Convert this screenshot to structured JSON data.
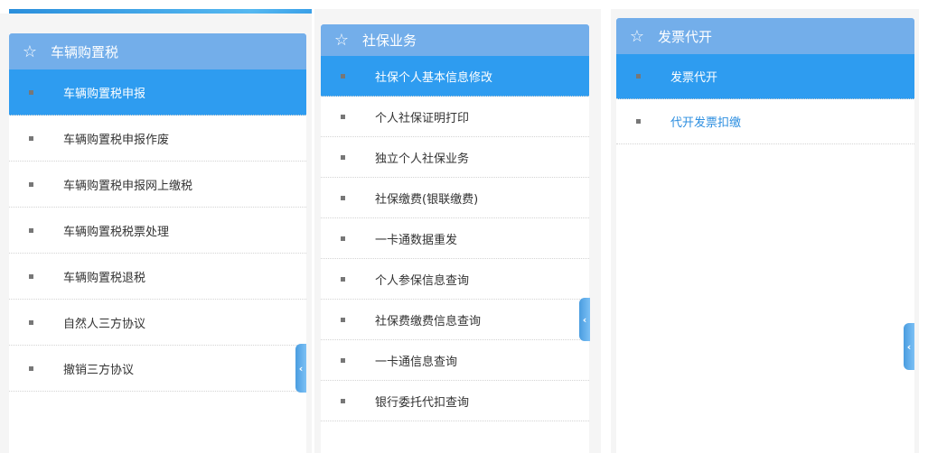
{
  "panels": [
    {
      "title": "车辆购置税",
      "items": [
        "车辆购置税申报",
        "车辆购置税申报作废",
        "车辆购置税申报网上缴税",
        "车辆购置税税票处理",
        "车辆购置税退税",
        "自然人三方协议",
        "撤销三方协议"
      ],
      "active": 0
    },
    {
      "title": "社保业务",
      "items": [
        "社保个人基本信息修改",
        "个人社保证明打印",
        "独立个人社保业务",
        "社保缴费(银联缴费)",
        "一卡通数据重发",
        "个人参保信息查询",
        "社保费缴费信息查询",
        "一卡通信息查询",
        "银行委托代扣查询"
      ],
      "active": 0
    },
    {
      "title": "发票代开",
      "items": [
        "发票代开",
        "代开发票扣缴"
      ],
      "active": 0
    }
  ],
  "icons": {
    "star": "☆",
    "collapse": "‹"
  }
}
